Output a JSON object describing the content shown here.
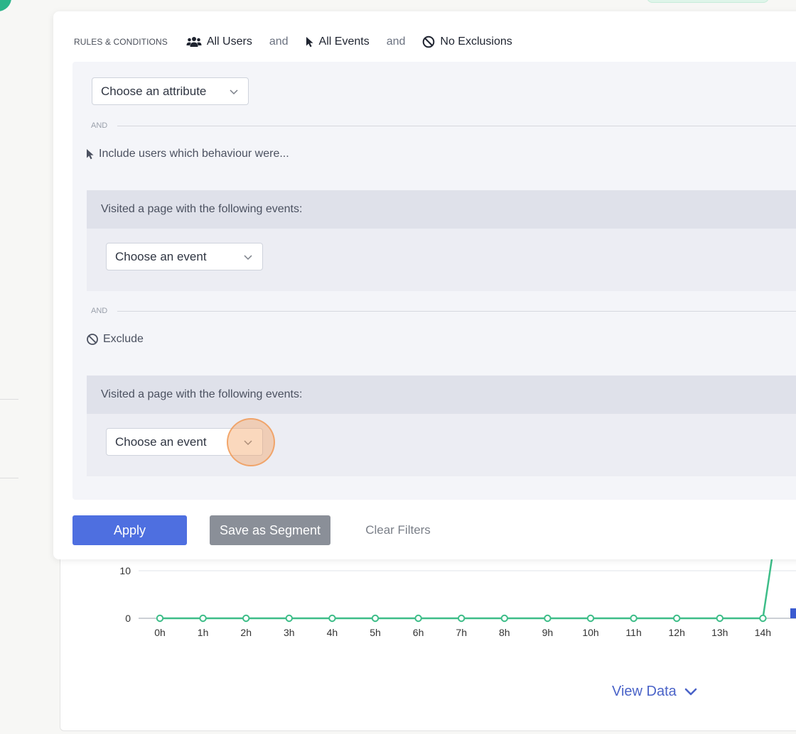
{
  "filter": {
    "rules_label": "RULES & CONDITIONS",
    "users_chip": "All Users",
    "conj_1": "and",
    "events_chip": "All Events",
    "conj_2": "and",
    "exclusions_chip": "No Exclusions"
  },
  "attribute_select": {
    "value": "Choose an attribute"
  },
  "and_label": "AND",
  "include": {
    "title": "Include users which behaviour were...",
    "box_header": "Visited a page with the following events:",
    "event_select": "Choose an event"
  },
  "exclude": {
    "title": "Exclude",
    "box_header": "Visited a page with the following events:",
    "event_select": "Choose an event"
  },
  "actions": {
    "apply": "Apply",
    "save_segment": "Save as Segment",
    "clear": "Clear Filters"
  },
  "chart": {
    "view_data": "View Data"
  },
  "chart_data": {
    "type": "line",
    "categories": [
      "0h",
      "1h",
      "2h",
      "3h",
      "4h",
      "5h",
      "6h",
      "7h",
      "8h",
      "9h",
      "10h",
      "11h",
      "12h",
      "13h",
      "14h"
    ],
    "series": [
      {
        "values": [
          0,
          0,
          0,
          0,
          0,
          0,
          0,
          0,
          0,
          0,
          0,
          0,
          0,
          0,
          0
        ],
        "color": "#3dbd88"
      }
    ],
    "y_ticks": [
      0,
      10
    ],
    "ylim": [
      0,
      12
    ],
    "grid": true
  },
  "colors": {
    "accent": "#4e6fe0",
    "line": "#3dbd88",
    "click_ring": "#f4a261"
  },
  "icons": [
    "users-icon",
    "pointer-icon",
    "ban-icon",
    "chevron-down-icon"
  ]
}
